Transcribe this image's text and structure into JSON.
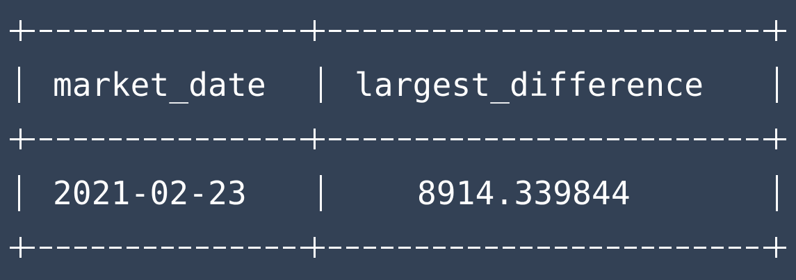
{
  "table": {
    "border": "+------------+--------------------+",
    "header": {
      "market_date": "market_date",
      "largest_difference": "largest_difference"
    },
    "rows": [
      {
        "market_date": "2021-02-23",
        "largest_difference": "8914.339844"
      }
    ]
  },
  "colors": {
    "background": "#334155",
    "text": "#ffffff"
  }
}
